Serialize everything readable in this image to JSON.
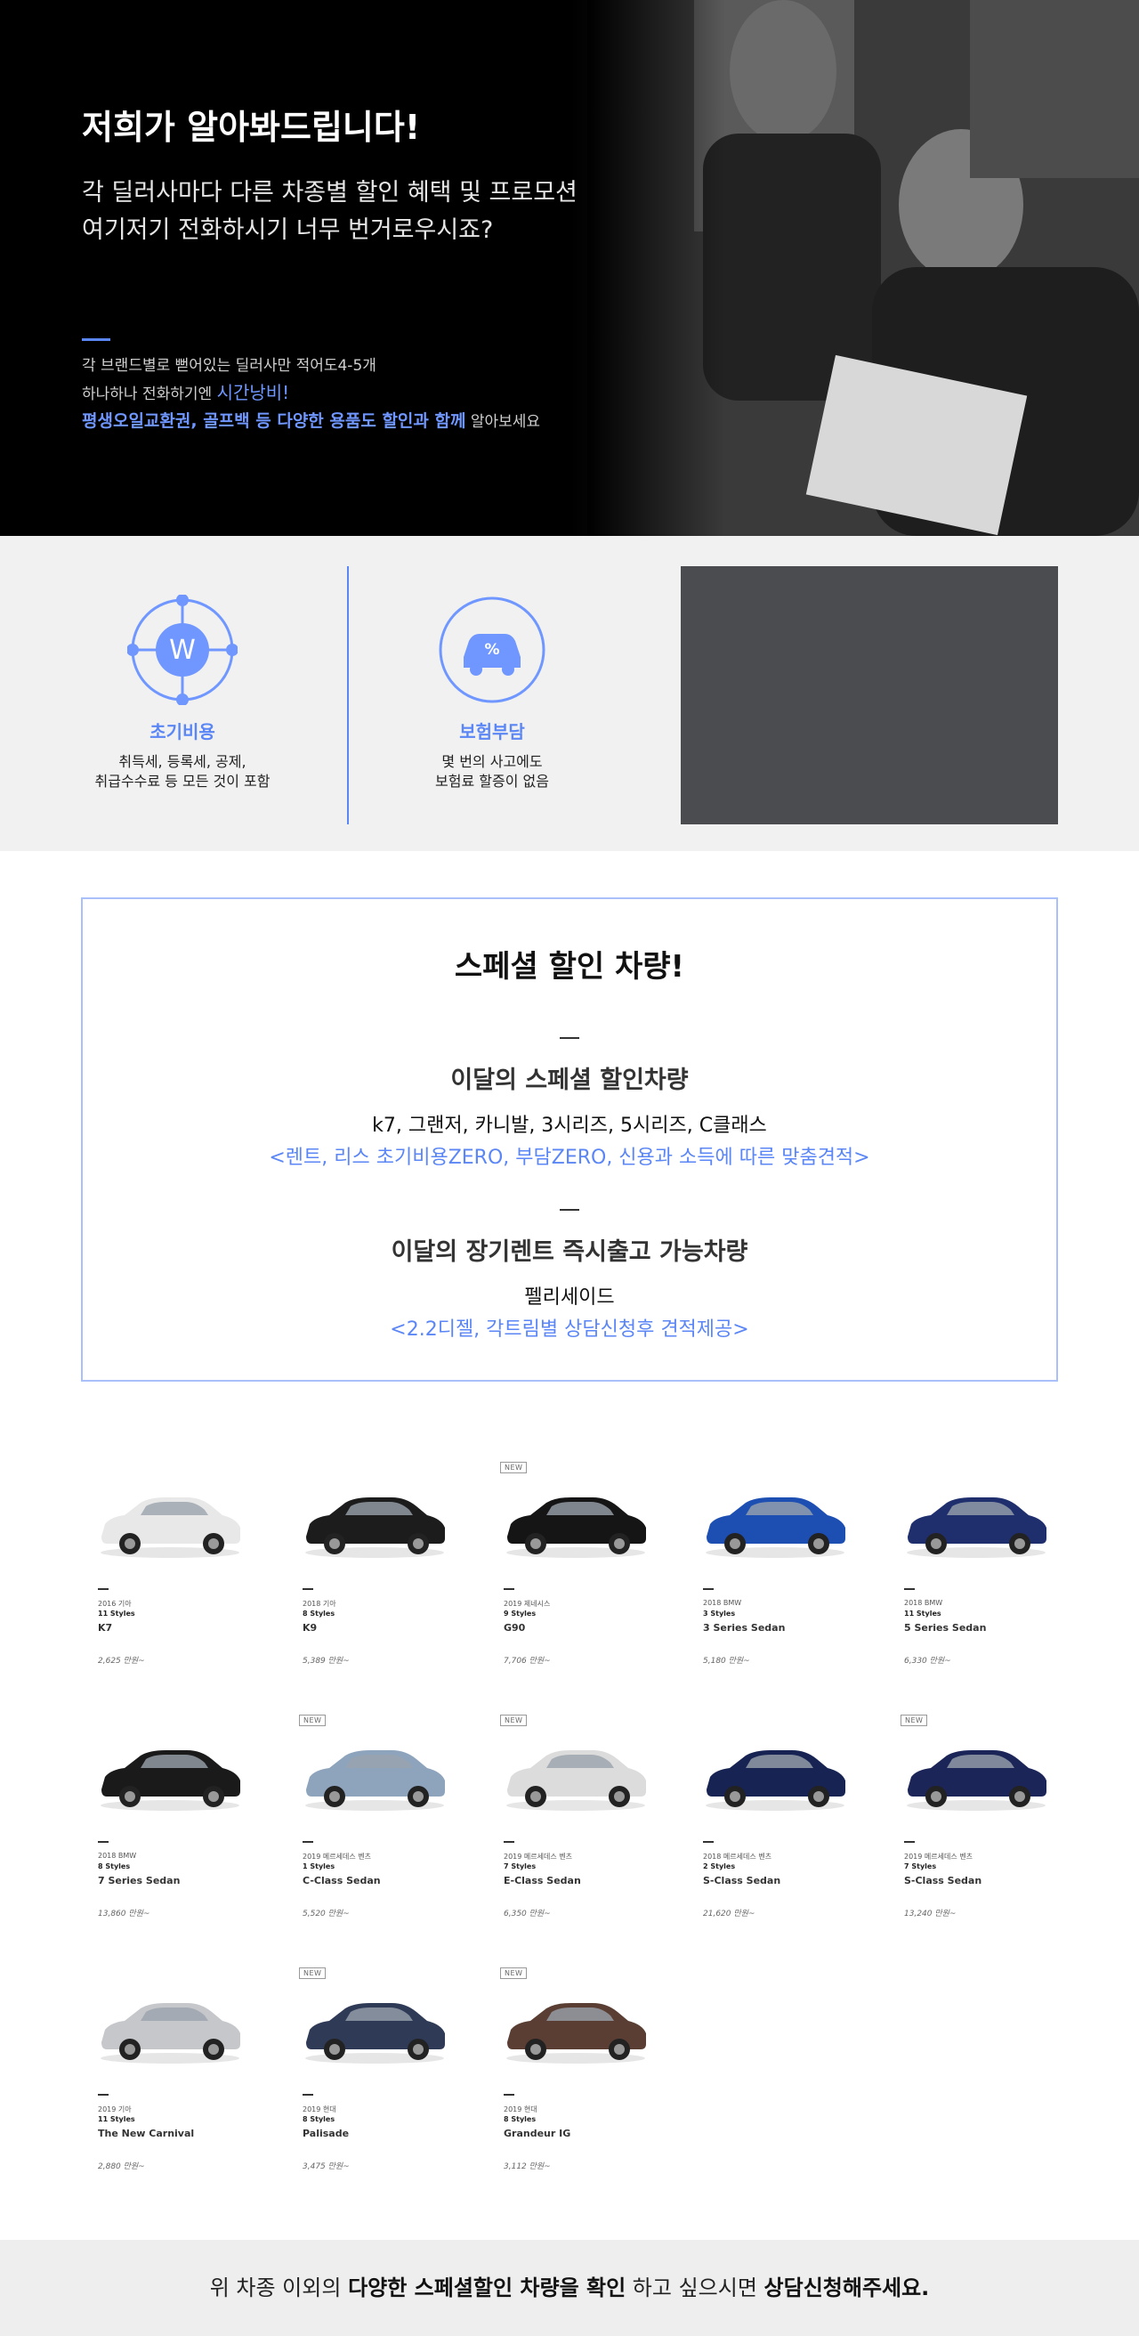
{
  "hero": {
    "title": "저희가 알아봐드립니다!",
    "subtitle_line1": "각 딜러사마다 다른 차종별 할인 혜택 및 프로모션",
    "subtitle_line2": "여기저기 전화하시기 너무 번거로우시죠?",
    "desc_line1": "각 브랜드별로 뻗어있는 딜러사만 적어도4-5개",
    "desc_line2_prefix": "하나하나 전화하기엔 ",
    "desc_line2_highlight": "시간낭비!",
    "desc_line3_highlight": "평생오일교환권, 골프백 등 다양한 용품도 할인과 함께",
    "desc_line3_suffix": " 알아보세요",
    "accent_color": "#5b86f5"
  },
  "features": [
    {
      "icon": "w-network-icon",
      "icon_letter": "W",
      "title": "초기비용",
      "desc": "취득세, 등록세, 공제,\n취급수수료 등 모든 것이 포함"
    },
    {
      "icon": "car-percent-icon",
      "icon_letter": "%",
      "title": "보험부담",
      "desc": "몇 번의 사고에도\n보험료 할증이 없음"
    }
  ],
  "special": {
    "title": "스페셜 할인 차량!",
    "block1": {
      "heading": "이달의 스페셜 할인차량",
      "list": "k7, 그랜저, 카니발, 3시리즈, 5시리즈, C클래스",
      "note": "<렌트, 리스 초기비용ZERO, 부담ZERO, 신용과 소득에 따른 맞춤견적>"
    },
    "block2": {
      "heading": "이달의 장기렌트 즉시출고 가능차량",
      "list": "펠리세이드",
      "note": "<2.2디젤, 각트림별 상담신청후 견적제공>"
    }
  },
  "cars": [
    {
      "new": "",
      "year": "2016 기아",
      "styles": "11 Styles",
      "name": "K7",
      "price": "2,625 만원~",
      "color": "#e8e8e8"
    },
    {
      "new": "",
      "year": "2018 기아",
      "styles": "8 Styles",
      "name": "K9",
      "price": "5,389 만원~",
      "color": "#1c1c1c"
    },
    {
      "new": "NEW",
      "year": "2019 제네시스",
      "styles": "9 Styles",
      "name": "G90",
      "price": "7,706 만원~",
      "color": "#151515"
    },
    {
      "new": "",
      "year": "2018 BMW",
      "styles": "3 Styles",
      "name": "3 Series Sedan",
      "price": "5,180 만원~",
      "color": "#1d4fb3"
    },
    {
      "new": "",
      "year": "2018 BMW",
      "styles": "11 Styles",
      "name": "5 Series Sedan",
      "price": "6,330 만원~",
      "color": "#1f2f6e"
    },
    {
      "new": "",
      "year": "2018 BMW",
      "styles": "8 Styles",
      "name": "7 Series Sedan",
      "price": "13,860 만원~",
      "color": "#1a1a1a"
    },
    {
      "new": "NEW",
      "year": "2019 메르세데스 벤츠",
      "styles": "1 Styles",
      "name": "C-Class Sedan",
      "price": "5,520 만원~",
      "color": "#8ea4bd"
    },
    {
      "new": "NEW",
      "year": "2019 메르세데스 벤츠",
      "styles": "7 Styles",
      "name": "E-Class Sedan",
      "price": "6,350 만원~",
      "color": "#dcdcdc"
    },
    {
      "new": "",
      "year": "2018 메르세데스 벤츠",
      "styles": "2 Styles",
      "name": "S-Class Sedan",
      "price": "21,620 만원~",
      "color": "#172352"
    },
    {
      "new": "NEW",
      "year": "2019 메르세데스 벤츠",
      "styles": "7 Styles",
      "name": "S-Class Sedan",
      "price": "13,240 만원~",
      "color": "#1b2557"
    },
    {
      "new": "",
      "year": "2019 기아",
      "styles": "11 Styles",
      "name": "The New Carnival",
      "price": "2,880 만원~",
      "color": "#c5c7ca"
    },
    {
      "new": "NEW",
      "year": "2019 현대",
      "styles": "8 Styles",
      "name": "Palisade",
      "price": "3,475 만원~",
      "color": "#2e3a56"
    },
    {
      "new": "NEW",
      "year": "2019 현대",
      "styles": "8 Styles",
      "name": "Grandeur IG",
      "price": "3,112 만원~",
      "color": "#5a3e33"
    }
  ],
  "footer": {
    "prefix": "위 차종 이외의 ",
    "bold1": "다양한 스페셜할인 차량을 확인",
    "middle": " 하고 싶으시면 ",
    "bold2": "상담신청해주세요."
  }
}
